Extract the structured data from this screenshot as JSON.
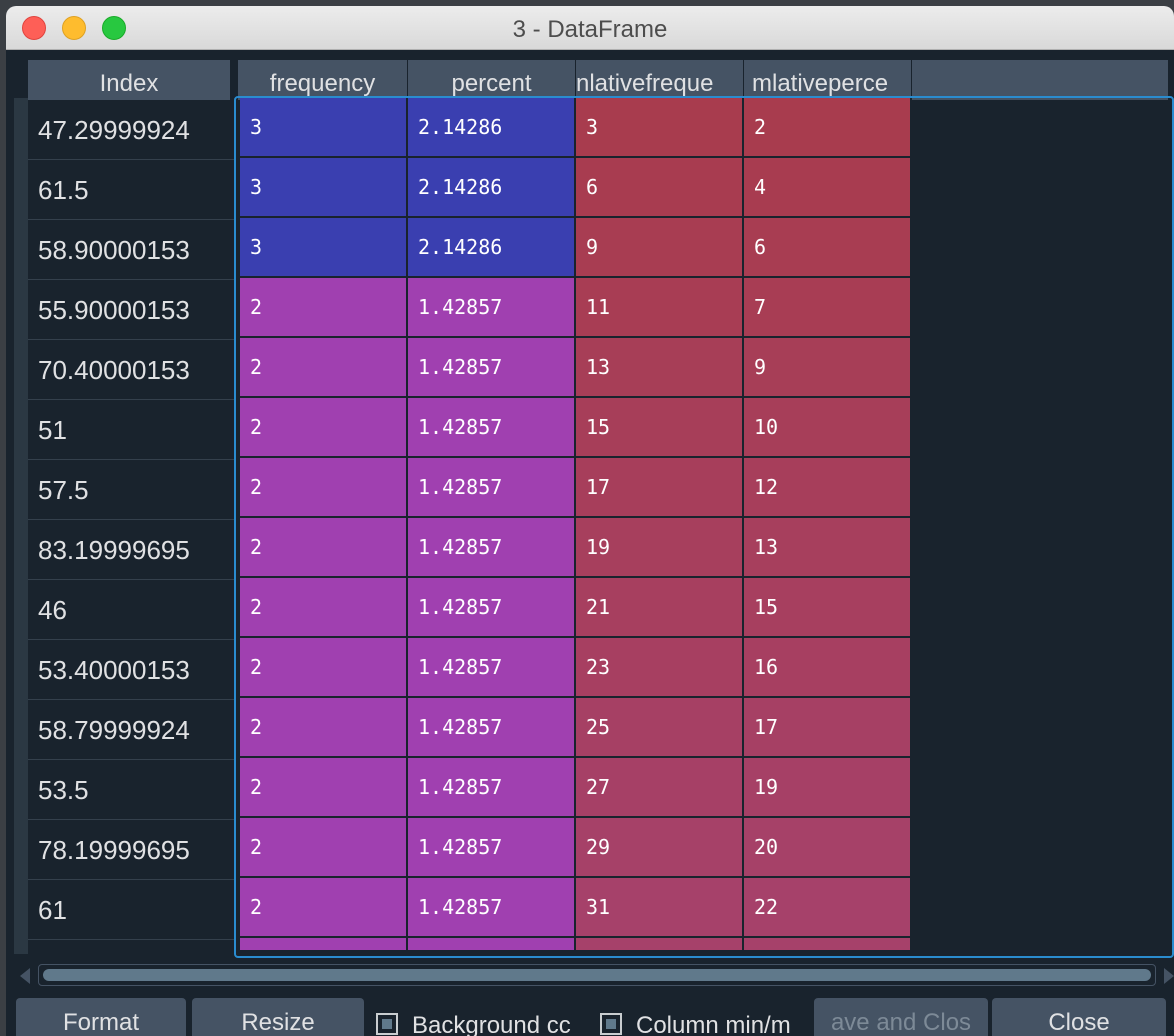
{
  "window": {
    "title": "3 - DataFrame"
  },
  "table": {
    "index_header": "Index",
    "columns": [
      "frequency",
      "percent",
      "nlativefreque",
      "mlativeperce"
    ],
    "rows": [
      {
        "index": "47.29999924",
        "frequency": "3",
        "percent": "2.14286",
        "cumfreq": "3",
        "cumperc": "2"
      },
      {
        "index": "61.5",
        "frequency": "3",
        "percent": "2.14286",
        "cumfreq": "6",
        "cumperc": "4"
      },
      {
        "index": "58.90000153",
        "frequency": "3",
        "percent": "2.14286",
        "cumfreq": "9",
        "cumperc": "6"
      },
      {
        "index": "55.90000153",
        "frequency": "2",
        "percent": "1.42857",
        "cumfreq": "11",
        "cumperc": "7"
      },
      {
        "index": "70.40000153",
        "frequency": "2",
        "percent": "1.42857",
        "cumfreq": "13",
        "cumperc": "9"
      },
      {
        "index": "51",
        "frequency": "2",
        "percent": "1.42857",
        "cumfreq": "15",
        "cumperc": "10"
      },
      {
        "index": "57.5",
        "frequency": "2",
        "percent": "1.42857",
        "cumfreq": "17",
        "cumperc": "12"
      },
      {
        "index": "83.19999695",
        "frequency": "2",
        "percent": "1.42857",
        "cumfreq": "19",
        "cumperc": "13"
      },
      {
        "index": "46",
        "frequency": "2",
        "percent": "1.42857",
        "cumfreq": "21",
        "cumperc": "15"
      },
      {
        "index": "53.40000153",
        "frequency": "2",
        "percent": "1.42857",
        "cumfreq": "23",
        "cumperc": "16"
      },
      {
        "index": "58.79999924",
        "frequency": "2",
        "percent": "1.42857",
        "cumfreq": "25",
        "cumperc": "17"
      },
      {
        "index": "53.5",
        "frequency": "2",
        "percent": "1.42857",
        "cumfreq": "27",
        "cumperc": "19"
      },
      {
        "index": "78.19999695",
        "frequency": "2",
        "percent": "1.42857",
        "cumfreq": "29",
        "cumperc": "20"
      },
      {
        "index": "61",
        "frequency": "2",
        "percent": "1.42857",
        "cumfreq": "31",
        "cumperc": "22"
      }
    ]
  },
  "colors": {
    "freq3": "#3a3fb0",
    "freq2": "#a040b0",
    "cum_top": "#a83c4e",
    "cum_bottom": "#a6416a",
    "selection_border": "#2a8ccf"
  },
  "toolbar": {
    "format_label": "Format",
    "resize_label": "Resize",
    "background_label": "Background cc",
    "minmax_label": "Column min/m",
    "save_close_label": "ave and Clos",
    "close_label": "Close"
  }
}
